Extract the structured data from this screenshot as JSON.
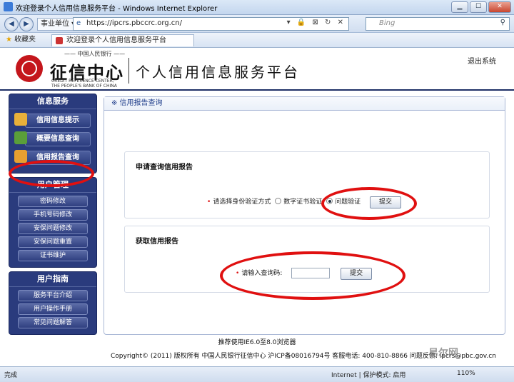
{
  "window": {
    "title": "欢迎登录个人信用信息服务平台 - Windows Internet Explorer",
    "min": "▁",
    "max": "☐",
    "close": "✕"
  },
  "address": {
    "back": "◀",
    "forward": "▶",
    "fav_label": "事业单位 ▾",
    "url": "https://ipcrs.pbccrc.org.cn/",
    "tools": "▾ 🔒 ⊠ ↻ ✕",
    "search_placeholder": "Bing",
    "search_icon": "⚲"
  },
  "tabs": {
    "favorites": "收藏夹",
    "favorites_icon": "★",
    "active_tab": "欢迎登录个人信用信息服务平台"
  },
  "header": {
    "org_top": "—— 中国人民银行 ——",
    "org_name": "征信中心",
    "org_en_1": "CREDIT REFERENCE CENTER,",
    "org_en_2": "THE PEOPLE'S BANK OF CHINA",
    "site_name": "个人信用信息服务平台",
    "logout": "退出系统"
  },
  "sidebar": {
    "info_service": {
      "title": "信息服务",
      "items": [
        "信用信息提示",
        "概要信息查询",
        "信用报告查询"
      ]
    },
    "user_mgmt": {
      "title": "用户管理",
      "items": [
        "密码修改",
        "手机号码修改",
        "安保问题修改",
        "安保问题重置",
        "证书维护"
      ]
    },
    "user_guide": {
      "title": "用户指南",
      "items": [
        "服务平台介绍",
        "用户操作手册",
        "常见问题解答"
      ]
    }
  },
  "content": {
    "title": "※ 信用报告查询",
    "apply": {
      "heading": "申请查询信用报告",
      "label": "请选择身份验证方式",
      "option_cert": "数字证书验证",
      "option_question": "问题验证",
      "submit": "提交"
    },
    "fetch": {
      "heading": "获取信用报告",
      "label": "请输入查询码:",
      "input_value": "",
      "submit": "提交"
    }
  },
  "footer": {
    "browser_note": "推荐使用IE6.0至8.0浏览器",
    "copyright": "Copyright© (2011) 版权所有 中国人民银行征信中心 沪ICP备08016794号 客服电话: 400-810-8866 问题反馈: ipcrs@pbc.gov.cn"
  },
  "status": {
    "left": "完成",
    "zone": "Internet | 保护模式: 启用",
    "zoom": "110%"
  },
  "watermark": "易尔网",
  "colors": {
    "sidebar": "#2a3b7d",
    "highlight": "#e01010",
    "accent": "#1d3c8a"
  }
}
